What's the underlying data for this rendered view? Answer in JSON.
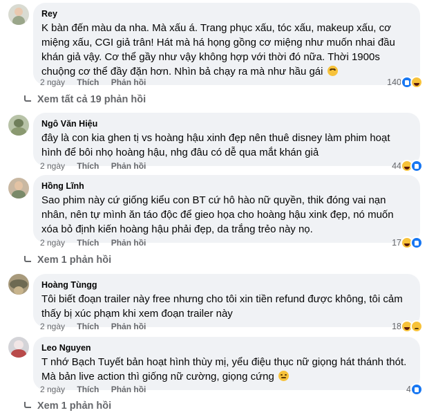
{
  "actions": {
    "like": "Thích",
    "reply": "Phản hồi"
  },
  "comments": [
    {
      "author": "Rey",
      "text": "K bàn đến màu da nha. Mà xấu á. Trang phục xấu, tóc xấu, makeup xấu, cơ miệng xấu, CGI giả trân! Hát mà há họng gồng cơ miệng như muốn nhai đầu khán giả vậy. Cơ thể gầy như vậy không hợp với thời đó nữa. Thời 1900s chuộng cơ thể đầy đặn hơn. Nhìn bả chạy ra mà như hầu gái",
      "emoji": "upside-down-face-icon",
      "time": "2 ngày",
      "reaction_count": "140",
      "reactions": [
        "like-reaction-icon",
        "haha-reaction-icon"
      ],
      "replies_label": "Xem tất cả 19 phản hồi"
    },
    {
      "author": "Ngô Văn Hiệu",
      "text": "đây là con kia ghen tị vs hoàng hậu xinh đẹp nên thuê disney làm phim hoạt hình để bôi nhọ hoàng hậu, nhg đâu có dễ qua mắt khán giả",
      "time": "2 ngày",
      "reaction_count": "44",
      "reactions": [
        "haha-reaction-icon",
        "like-reaction-icon"
      ]
    },
    {
      "author": "Hồng Lĩnh",
      "text": "Sao phim này cứ giống kiểu con BT cứ hô hào nữ quyền, thik đóng vai nạn nhân, nên tự mình ăn táo độc để gieo họa cho hoàng hậu xink đẹp, nó muốn xóa bỏ định kiến hoàng hậu phải đẹp, da trắng trẻo này nọ.",
      "time": "2 ngày",
      "reaction_count": "17",
      "reactions": [
        "haha-reaction-icon",
        "like-reaction-icon"
      ],
      "replies_label": "Xem 1 phản hồi"
    },
    {
      "author": "Hoàng Tùngg",
      "text": "Tôi biết đoạn trailer này free nhưng cho tôi xin tiền refund được không, tôi cảm thấy bị xúc phạm khi xem đoạn trailer này",
      "time": "2 ngày",
      "reaction_count": "18",
      "reactions": [
        "haha-reaction-icon",
        "sad-reaction-icon"
      ]
    },
    {
      "author": "Leo Nguyen",
      "text": "T nhớ Bạch Tuyết bản hoạt hình thùy mị, yểu điệu thục nữ giọng hát thánh thót. Mà bản live action thì giống nữ cường, giọng cứng",
      "emoji": "unamused-face-icon",
      "time": "2 ngày",
      "reaction_count": "4",
      "reactions": [
        "like-reaction-icon"
      ],
      "replies_label": "Xem 1 phản hồi"
    }
  ],
  "colors": {
    "bubble": "#f0f2f5",
    "meta": "#65676b",
    "like": "#1877f2",
    "emoji": "#f7c23a"
  }
}
